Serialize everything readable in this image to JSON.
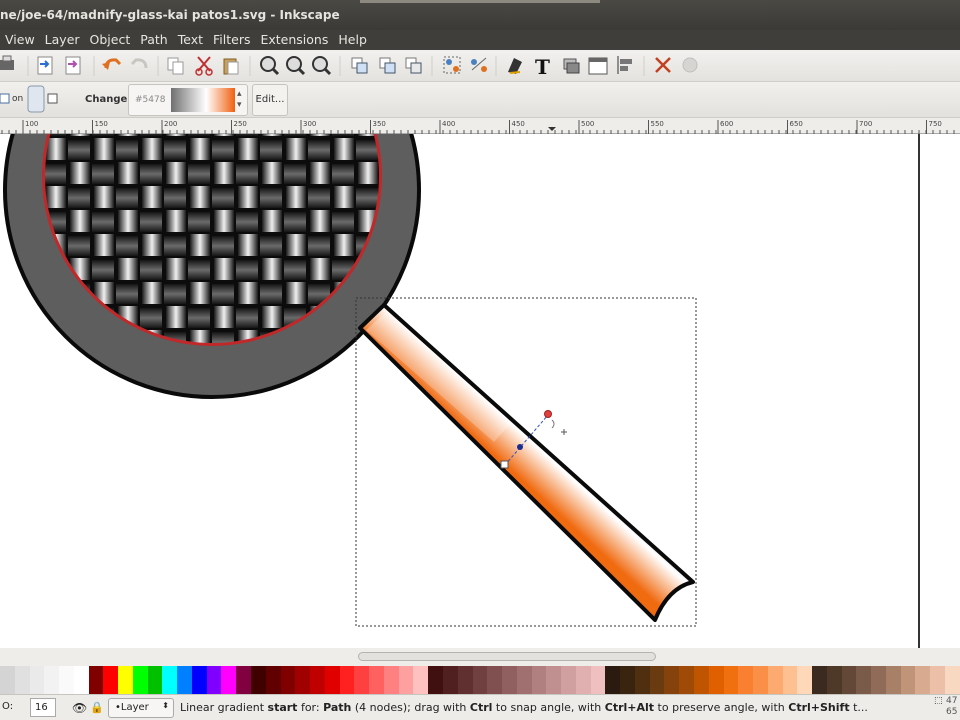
{
  "window": {
    "title": "ne/joe-64/madnify-glass-kai patos1.svg - Inkscape"
  },
  "menu": [
    "View",
    "Layer",
    "Object",
    "Path",
    "Text",
    "Filters",
    "Extensions",
    "Help"
  ],
  "toolbar_icons": [
    "print-icon",
    "import-icon",
    "export-icon",
    "undo-icon",
    "redo-icon",
    "copy-icon",
    "cut-icon",
    "paste-icon",
    "zoom-selection-icon",
    "zoom-drawing-icon",
    "zoom-page-icon",
    "duplicate-icon",
    "clone-icon",
    "unlink-clone-icon",
    "group-icon",
    "ungroup-icon",
    "fill-stroke-icon",
    "text-tool-icon",
    "layers-icon",
    "xml-editor-icon",
    "align-icon",
    "preferences-icon",
    "inkscape-icon"
  ],
  "gradient_controls": {
    "on_label": "on",
    "change_label": "Change:",
    "gradient_name": "#5478",
    "edit_label": "Edit..."
  },
  "ruler": {
    "ticks": [
      "100",
      "150",
      "200",
      "250",
      "300",
      "350",
      "400",
      "450",
      "500",
      "550",
      "600",
      "650",
      "700",
      "750"
    ]
  },
  "statusbar": {
    "opacity_label": "O:",
    "opacity_value": "16",
    "layer_label": "•Layer",
    "message_prefix": "Linear gradient ",
    "message_start": "start",
    "message_for": " for: ",
    "message_path": "Path",
    "message_middle": " (4 nodes); drag with ",
    "message_ctrl": "Ctrl",
    "message_snap": " to snap angle, with ",
    "message_ctrlalt": "Ctrl+Alt",
    "message_preserve": " to preserve angle, with ",
    "message_ctrlshift": "Ctrl+Shift",
    "message_end": " t...",
    "coord_x": "47",
    "coord_y": "65"
  },
  "colors": {
    "accent_orange": "#f07010",
    "glass_rim": "#5a5a5a",
    "rim_highlight": "#c0282a"
  },
  "palette": [
    "#d4d4d4",
    "#e0e0e0",
    "#eaeaea",
    "#f2f2f2",
    "#fafafa",
    "#ffffff",
    "#800000",
    "#ff0000",
    "#ffff00",
    "#00ff00",
    "#00c000",
    "#00ffff",
    "#0080ff",
    "#0000ff",
    "#8000ff",
    "#ff00ff",
    "#800040",
    "#400000",
    "#600000",
    "#800000",
    "#a00000",
    "#c00000",
    "#e00000",
    "#ff2020",
    "#ff4040",
    "#ff6060",
    "#ff8080",
    "#ffa0a0",
    "#ffc0c0",
    "#401010",
    "#502020",
    "#603030",
    "#704040",
    "#805050",
    "#906060",
    "#a07070",
    "#b08080",
    "#c09090",
    "#d0a0a0",
    "#e0b0b0",
    "#f0c0c0",
    "#2a1a10",
    "#3a2410",
    "#502f10",
    "#6a3a10",
    "#86420c",
    "#a04a08",
    "#c05500",
    "#e06000",
    "#f07010",
    "#f88030",
    "#fa9048",
    "#fcaa70",
    "#fdc090",
    "#fed8b8",
    "#3b2a20",
    "#4e3828",
    "#634838",
    "#7a5a48",
    "#906c58",
    "#a88068",
    "#c09478",
    "#d8aa90",
    "#ecc0a8",
    "#f8d8c0"
  ]
}
